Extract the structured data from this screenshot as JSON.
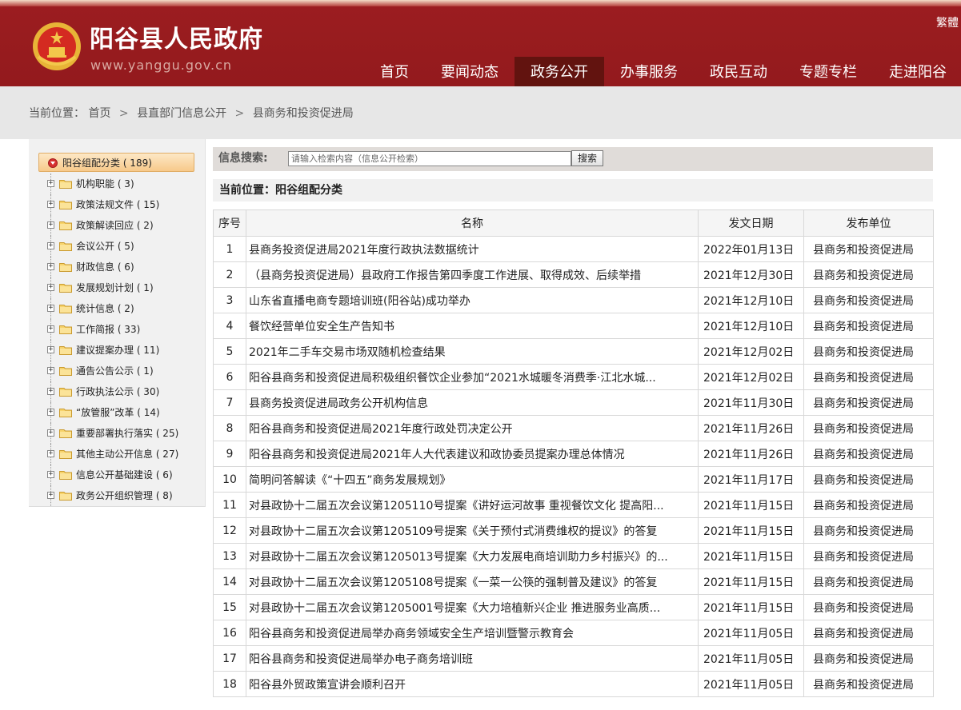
{
  "header": {
    "title": "阳谷县人民政府",
    "url": "www.yanggu.gov.cn",
    "lang_switch": "繁體",
    "nav": [
      "首页",
      "要闻动态",
      "政务公开",
      "办事服务",
      "政民互动",
      "专题专栏",
      "走进阳谷"
    ],
    "active_nav": "政务公开",
    "colors": {
      "primary": "#9c1d20",
      "nav_active": "#62130f"
    }
  },
  "breadcrumb": {
    "label": "当前位置：",
    "items": [
      "首页",
      "县直部门信息公开",
      "县商务和投资促进局"
    ],
    "separator": ">"
  },
  "sidebar": {
    "root": {
      "label": "阳谷组配分类 ( 189)",
      "icon": "collapse-icon"
    },
    "items": [
      {
        "label": "机构职能 ( 3)"
      },
      {
        "label": "政策法规文件 ( 15)"
      },
      {
        "label": "政策解读回应 ( 2)"
      },
      {
        "label": "会议公开 ( 5)"
      },
      {
        "label": "财政信息 ( 6)"
      },
      {
        "label": "发展规划计划 ( 1)"
      },
      {
        "label": "统计信息 ( 2)"
      },
      {
        "label": "工作简报 ( 33)"
      },
      {
        "label": "建议提案办理 ( 11)"
      },
      {
        "label": "通告公告公示 ( 1)"
      },
      {
        "label": "行政执法公示 ( 30)"
      },
      {
        "label": "“放管服”改革 ( 14)"
      },
      {
        "label": "重要部署执行落实 ( 25)"
      },
      {
        "label": "其他主动公开信息 ( 27)"
      },
      {
        "label": "信息公开基础建设 ( 6)"
      },
      {
        "label": "政务公开组织管理 ( 8)"
      }
    ]
  },
  "search": {
    "label": "信息搜索:",
    "placeholder": "请输入检索内容（信息公开检索）",
    "button": "搜索"
  },
  "current_position": "当前位置：阳谷组配分类",
  "table": {
    "headers": [
      "序号",
      "名称",
      "发文日期",
      "发布单位"
    ],
    "rows": [
      {
        "idx": "1",
        "name": "县商务投资促进局2021年度行政执法数据统计",
        "date": "2022年01月13日",
        "unit": "县商务和投资促进局"
      },
      {
        "idx": "2",
        "name": "（县商务投资促进局）县政府工作报告第四季度工作进展、取得成效、后续举措",
        "date": "2021年12月30日",
        "unit": "县商务和投资促进局"
      },
      {
        "idx": "3",
        "name": "山东省直播电商专题培训班(阳谷站)成功举办",
        "date": "2021年12月10日",
        "unit": "县商务和投资促进局"
      },
      {
        "idx": "4",
        "name": "餐饮经营单位安全生产告知书",
        "date": "2021年12月10日",
        "unit": "县商务和投资促进局"
      },
      {
        "idx": "5",
        "name": "2021年二手车交易市场双随机检查结果",
        "date": "2021年12月02日",
        "unit": "县商务和投资促进局"
      },
      {
        "idx": "6",
        "name": "阳谷县商务和投资促进局积极组织餐饮企业参加“2021水城暖冬消费季·江北水城...",
        "date": "2021年12月02日",
        "unit": "县商务和投资促进局"
      },
      {
        "idx": "7",
        "name": "县商务投资促进局政务公开机构信息",
        "date": "2021年11月30日",
        "unit": "县商务和投资促进局"
      },
      {
        "idx": "8",
        "name": "阳谷县商务和投资促进局2021年度行政处罚决定公开",
        "date": "2021年11月26日",
        "unit": "县商务和投资促进局"
      },
      {
        "idx": "9",
        "name": "阳谷县商务和投资促进局2021年人大代表建议和政协委员提案办理总体情况",
        "date": "2021年11月26日",
        "unit": "县商务和投资促进局"
      },
      {
        "idx": "10",
        "name": "简明问答解读《“十四五”商务发展规划》",
        "date": "2021年11月17日",
        "unit": "县商务和投资促进局"
      },
      {
        "idx": "11",
        "name": "对县政协十二届五次会议第1205110号提案《讲好运河故事 重视餐饮文化 提高阳...",
        "date": "2021年11月15日",
        "unit": "县商务和投资促进局"
      },
      {
        "idx": "12",
        "name": "对县政协十二届五次会议第1205109号提案《关于预付式消费维权的提议》的答复",
        "date": "2021年11月15日",
        "unit": "县商务和投资促进局"
      },
      {
        "idx": "13",
        "name": "对县政协十二届五次会议第1205013号提案《大力发展电商培训助力乡村振兴》的...",
        "date": "2021年11月15日",
        "unit": "县商务和投资促进局"
      },
      {
        "idx": "14",
        "name": "对县政协十二届五次会议第1205108号提案《一菜一公筷的强制普及建议》的答复",
        "date": "2021年11月15日",
        "unit": "县商务和投资促进局"
      },
      {
        "idx": "15",
        "name": "对县政协十二届五次会议第1205001号提案《大力培植新兴企业 推进服务业高质...",
        "date": "2021年11月15日",
        "unit": "县商务和投资促进局"
      },
      {
        "idx": "16",
        "name": "阳谷县商务和投资促进局举办商务领域安全生产培训暨警示教育会",
        "date": "2021年11月05日",
        "unit": "县商务和投资促进局"
      },
      {
        "idx": "17",
        "name": "阳谷县商务和投资促进局举办电子商务培训班",
        "date": "2021年11月05日",
        "unit": "县商务和投资促进局"
      },
      {
        "idx": "18",
        "name": "阳谷县外贸政策宣讲会顺利召开",
        "date": "2021年11月05日",
        "unit": "县商务和投资促进局"
      }
    ]
  }
}
